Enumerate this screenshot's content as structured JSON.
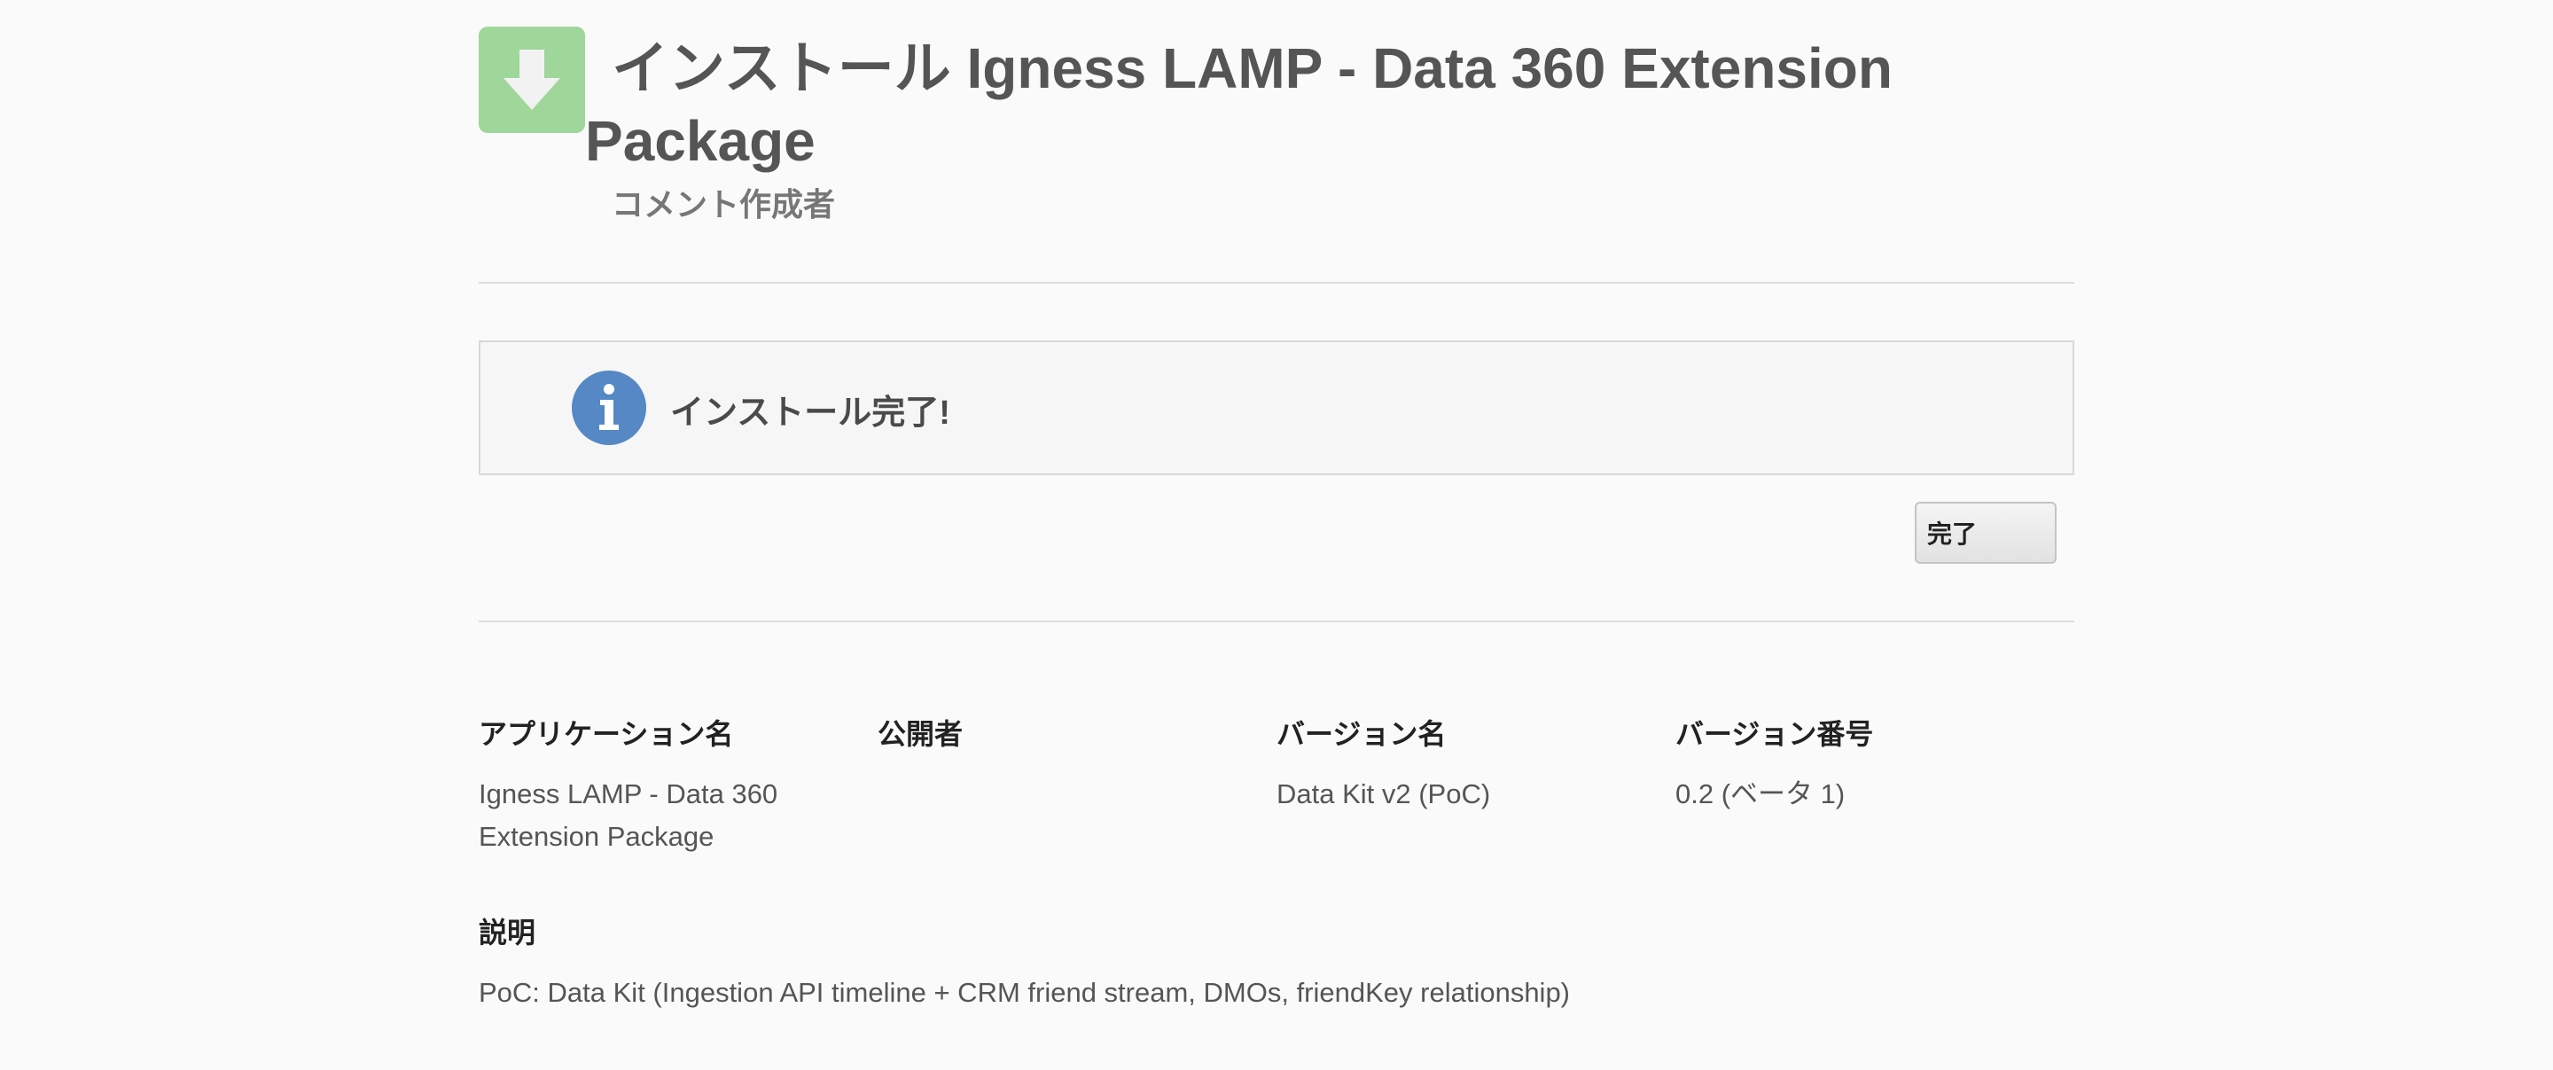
{
  "header": {
    "title": "インストール Igness LAMP - Data 360 Extension Package",
    "subtitle": "コメント作成者",
    "icon": "download-arrow-icon",
    "icon_color": "#9fd69a"
  },
  "message": {
    "icon": "info-icon",
    "icon_color": "#5588c4",
    "text": "インストール完了!"
  },
  "actions": {
    "done_label": "完了"
  },
  "details": {
    "app_name_label": "アプリケーション名",
    "app_name_value": "Igness LAMP - Data 360 Extension Package",
    "publisher_label": "公開者",
    "publisher_value": "",
    "version_name_label": "バージョン名",
    "version_name_value": "Data Kit v2 (PoC)",
    "version_number_label": "バージョン番号",
    "version_number_value": "0.2 (ベータ 1)",
    "description_label": "説明",
    "description_value": "PoC: Data Kit (Ingestion API timeline + CRM friend stream, DMOs, friendKey relationship)"
  }
}
